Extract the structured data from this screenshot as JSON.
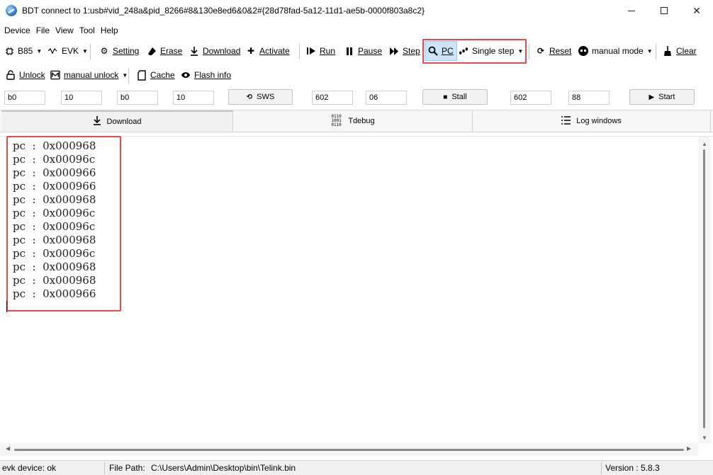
{
  "window": {
    "title": "BDT connect to 1:usb#vid_248a&pid_8266#8&130e8ed6&0&2#{28d78fad-5a12-11d1-ae5b-0000f803a8c2}"
  },
  "menu": [
    "Device",
    "File",
    "View",
    "Tool",
    "Help"
  ],
  "toolbar1": {
    "chip": "B85",
    "board": "EVK",
    "setting": "Setting",
    "erase": "Erase",
    "download": "Download",
    "activate": "Activate",
    "run": "Run",
    "pause": "Pause",
    "step": "Step",
    "pc": "PC",
    "single_step": "Single step",
    "reset": "Reset",
    "manual_mode": "manual mode",
    "clear": "Clear"
  },
  "toolbar2": {
    "unlock": "Unlock",
    "manual_unlock": "manual unlock",
    "cache": "Cache",
    "flash_info": "Flash info"
  },
  "fields": {
    "f1": "b0",
    "f2": "10",
    "f3": "b0",
    "f4": "10",
    "sws_label": "SWS",
    "f5": "602",
    "f6": "06",
    "stall_label": "Stall",
    "f7": "602",
    "f8": "88",
    "start_label": "Start"
  },
  "tabs": {
    "download": "Download",
    "tdebug": "Tdebug",
    "log": "Log windows"
  },
  "log_lines": [
    "pc  :  0x000968",
    "pc  :  0x00096c",
    "pc  :  0x000966",
    "pc  :  0x000966",
    "pc  :  0x000968",
    "pc  :  0x00096c",
    "pc  :  0x00096c",
    "pc  :  0x000968",
    "pc  :  0x00096c",
    "pc  :  0x000968",
    "pc  :  0x000968",
    "pc  :  0x000966"
  ],
  "status": {
    "device": "evk device: ok",
    "file_path_label": "File Path:",
    "file_path": "C:\\Users\\Admin\\Desktop\\bin\\Telink.bin",
    "version": "Version : 5.8.3"
  },
  "colors": {
    "highlight_box": "#e5484d",
    "pc_button_active": "#cce4f7"
  }
}
